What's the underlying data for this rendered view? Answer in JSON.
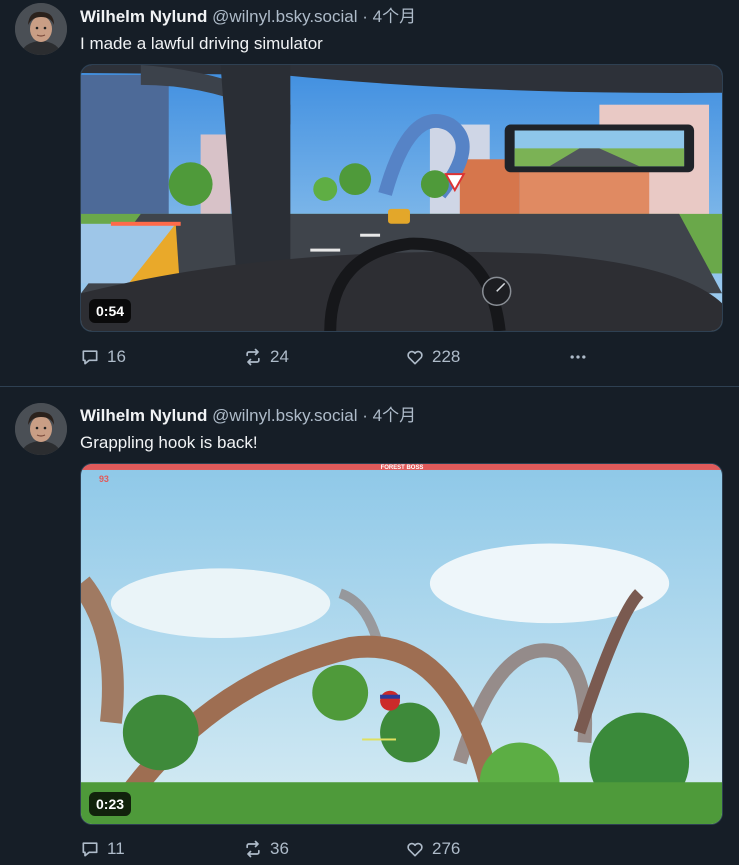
{
  "posts": [
    {
      "author": {
        "display_name": "Wilhelm Nylund",
        "handle": "@wilnyl.bsky.social"
      },
      "separator": "·",
      "timestamp": "4个月",
      "text": "I made a lawful driving simulator",
      "video": {
        "duration": "0:54"
      },
      "stats": {
        "replies": "16",
        "reposts": "24",
        "likes": "228"
      }
    },
    {
      "author": {
        "display_name": "Wilhelm Nylund",
        "handle": "@wilnyl.bsky.social"
      },
      "separator": "·",
      "timestamp": "4个月",
      "text": "Grappling hook is back!",
      "video": {
        "duration": "0:23",
        "hud_title": "FOREST BOSS",
        "hud_score": "93"
      },
      "stats": {
        "replies": "11",
        "reposts": "36",
        "likes": "276"
      }
    }
  ],
  "colors": {
    "background": "#161e27",
    "text": "#f1f3f5",
    "muted": "#aebbc9",
    "border": "#2e4052"
  },
  "icons": [
    "reply-icon",
    "repost-icon",
    "like-icon",
    "more-icon"
  ]
}
